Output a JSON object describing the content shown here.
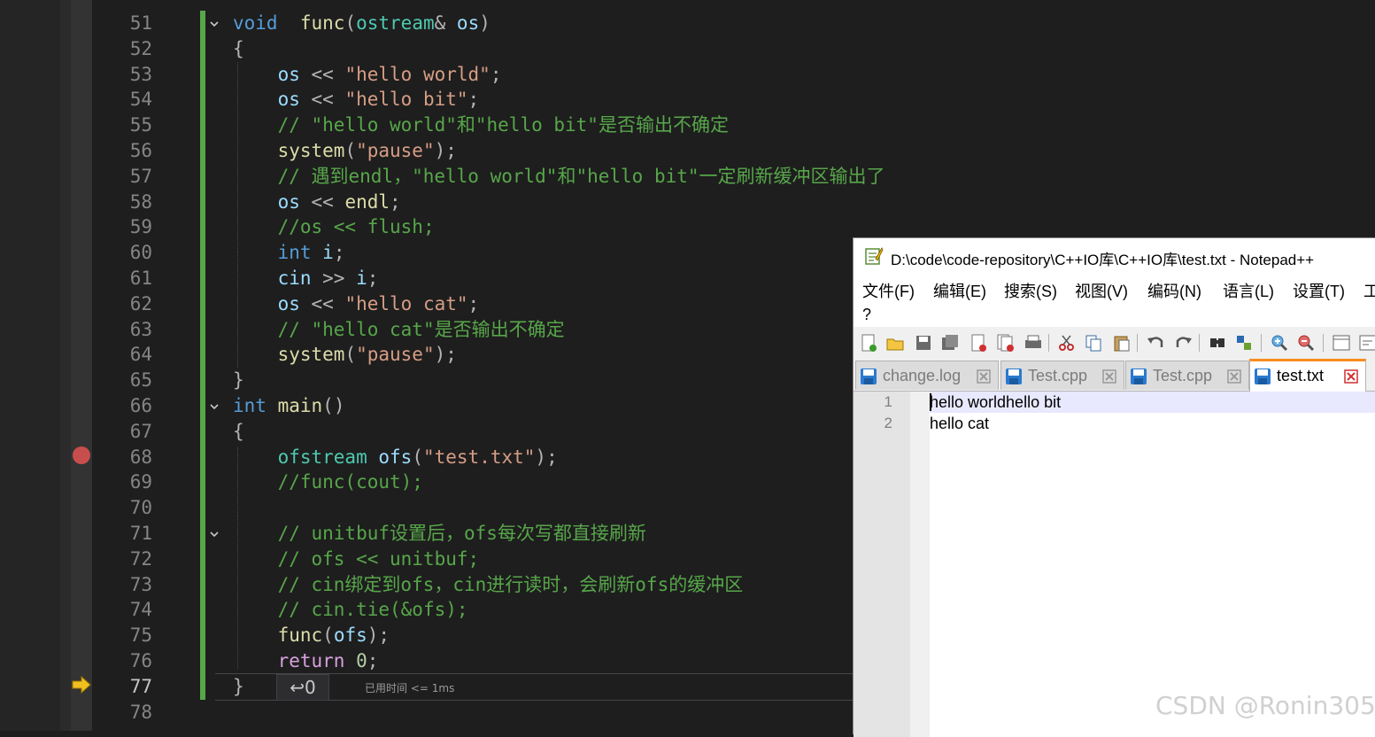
{
  "editor": {
    "line_numbers": [
      "51",
      "52",
      "53",
      "54",
      "55",
      "56",
      "57",
      "58",
      "59",
      "60",
      "61",
      "62",
      "63",
      "64",
      "65",
      "66",
      "67",
      "68",
      "69",
      "70",
      "71",
      "72",
      "73",
      "74",
      "75",
      "76",
      "77",
      "78"
    ],
    "current_line": "77",
    "lines": [
      [
        [
          "kw",
          "void"
        ],
        [
          "",
          "  "
        ],
        [
          "fn",
          "func"
        ],
        [
          "op",
          "("
        ],
        [
          "ty",
          "ostream"
        ],
        [
          "op",
          "& "
        ],
        [
          "id",
          "os"
        ],
        [
          "op",
          ")"
        ]
      ],
      [
        [
          "op",
          "{"
        ]
      ],
      [
        [
          "",
          "    "
        ],
        [
          "id",
          "os"
        ],
        [
          "op",
          " << "
        ],
        [
          "st",
          "\"hello world\""
        ],
        [
          "op",
          ";"
        ]
      ],
      [
        [
          "",
          "    "
        ],
        [
          "id",
          "os"
        ],
        [
          "op",
          " << "
        ],
        [
          "st",
          "\"hello bit\""
        ],
        [
          "op",
          ";"
        ]
      ],
      [
        [
          "",
          "    "
        ],
        [
          "cm",
          "// \"hello world\"和\"hello bit\"是否输出不确定"
        ]
      ],
      [
        [
          "",
          "    "
        ],
        [
          "fn",
          "system"
        ],
        [
          "op",
          "("
        ],
        [
          "st",
          "\"pause\""
        ],
        [
          "op",
          ");"
        ]
      ],
      [
        [
          "",
          "    "
        ],
        [
          "cm",
          "// 遇到endl，\"hello world\"和\"hello bit\"一定刷新缓冲区输出了"
        ]
      ],
      [
        [
          "",
          "    "
        ],
        [
          "id",
          "os"
        ],
        [
          "op",
          " << "
        ],
        [
          "fn",
          "endl"
        ],
        [
          "op",
          ";"
        ]
      ],
      [
        [
          "",
          "    "
        ],
        [
          "cm",
          "//os << flush;"
        ]
      ],
      [
        [
          "",
          "    "
        ],
        [
          "kw",
          "int"
        ],
        [
          "op",
          " "
        ],
        [
          "id",
          "i"
        ],
        [
          "op",
          ";"
        ]
      ],
      [
        [
          "",
          "    "
        ],
        [
          "id",
          "cin"
        ],
        [
          "op",
          " >> "
        ],
        [
          "id",
          "i"
        ],
        [
          "op",
          ";"
        ]
      ],
      [
        [
          "",
          "    "
        ],
        [
          "id",
          "os"
        ],
        [
          "op",
          " << "
        ],
        [
          "st",
          "\"hello cat\""
        ],
        [
          "op",
          ";"
        ]
      ],
      [
        [
          "",
          "    "
        ],
        [
          "cm",
          "// \"hello cat\"是否输出不确定"
        ]
      ],
      [
        [
          "",
          "    "
        ],
        [
          "fn",
          "system"
        ],
        [
          "op",
          "("
        ],
        [
          "st",
          "\"pause\""
        ],
        [
          "op",
          ");"
        ]
      ],
      [
        [
          "op",
          "}"
        ]
      ],
      [
        [
          "kw",
          "int"
        ],
        [
          "op",
          " "
        ],
        [
          "fn",
          "main"
        ],
        [
          "op",
          "()"
        ]
      ],
      [
        [
          "op",
          "{"
        ]
      ],
      [
        [
          "",
          "    "
        ],
        [
          "ty",
          "ofstream"
        ],
        [
          "op",
          " "
        ],
        [
          "id",
          "ofs"
        ],
        [
          "op",
          "("
        ],
        [
          "st",
          "\"test.txt\""
        ],
        [
          "op",
          ");"
        ]
      ],
      [
        [
          "",
          "    "
        ],
        [
          "cm",
          "//func(cout);"
        ]
      ],
      [],
      [
        [
          "",
          "    "
        ],
        [
          "cm",
          "// unitbuf设置后，ofs每次写都直接刷新"
        ]
      ],
      [
        [
          "",
          "    "
        ],
        [
          "cm",
          "// ofs << unitbuf;"
        ]
      ],
      [
        [
          "",
          "    "
        ],
        [
          "cm",
          "// cin绑定到ofs，cin进行读时，会刷新ofs的缓冲区"
        ]
      ],
      [
        [
          "",
          "    "
        ],
        [
          "cm",
          "// cin.tie(&ofs);"
        ]
      ],
      [
        [
          "",
          "    "
        ],
        [
          "fn",
          "func"
        ],
        [
          "op",
          "("
        ],
        [
          "id",
          "ofs"
        ],
        [
          "op",
          ");"
        ]
      ],
      [
        [
          "",
          "    "
        ],
        [
          "ctl",
          "return"
        ],
        [
          "op",
          " "
        ],
        [
          "nm",
          "0"
        ],
        [
          "op",
          ";"
        ]
      ],
      [
        [
          "op",
          "}"
        ]
      ],
      []
    ],
    "return_value": "↩0",
    "elapsed_text": "已用时间 <= 1ms"
  },
  "notepad": {
    "title": "D:\\code\\code-repository\\C++IO库\\C++IO库\\test.txt - Notepad++",
    "menu": [
      "文件(F)",
      "编辑(E)",
      "搜索(S)",
      "视图(V)",
      "编码(N)",
      "语言(L)",
      "设置(T)",
      "工"
    ],
    "help": "?",
    "tabs": [
      {
        "label": "change.log",
        "active": false
      },
      {
        "label": "Test.cpp",
        "active": false
      },
      {
        "label": "Test.cpp",
        "active": false
      },
      {
        "label": "test.txt",
        "active": true
      }
    ],
    "lines": [
      {
        "num": "1",
        "text": "hello worldhello bit"
      },
      {
        "num": "2",
        "text": "hello cat"
      }
    ]
  },
  "watermark": "CSDN @Ronin305",
  "colors": {
    "keyword": "#569cd6",
    "function": "#dcdcaa",
    "type": "#4ec9b0",
    "string": "#d69d85",
    "comment": "#57a64a",
    "identifier": "#9cdcfe",
    "breakpoint": "#c84e4e",
    "change_bar": "#57a64a",
    "active_tab_accent": "#fa8c1e"
  }
}
